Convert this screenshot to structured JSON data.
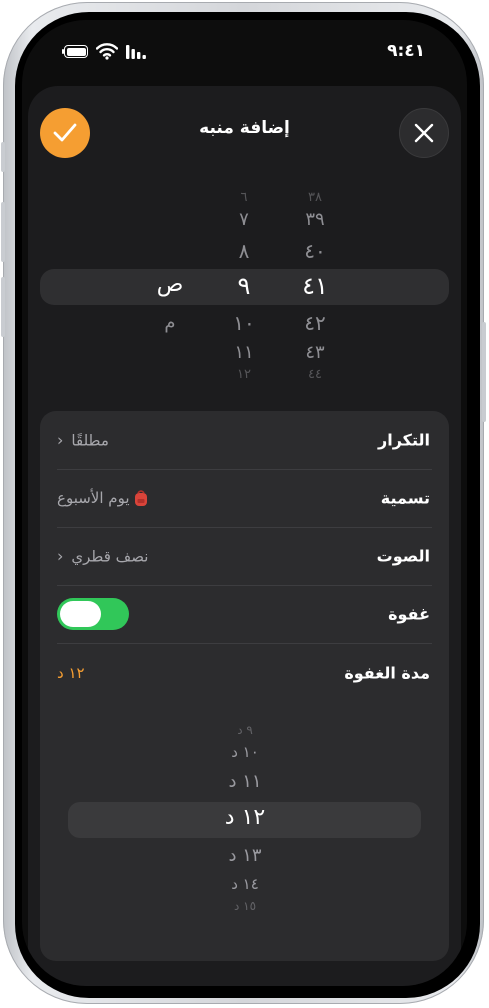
{
  "status_bar": {
    "time": "٩:٤١",
    "icons": [
      "battery-icon",
      "wifi-icon",
      "cellular-signal-icon"
    ]
  },
  "sheet": {
    "title": "إضافة منبه",
    "confirm_icon": "checkmark-icon",
    "close_icon": "close-icon"
  },
  "time_picker": {
    "minutes": [
      "٣٨",
      "٣٩",
      "٤٠",
      "٤١",
      "٤٢",
      "٤٣",
      "٤٤"
    ],
    "hours": [
      "٦",
      "٧",
      "٨",
      "٩",
      "١٠",
      "١١",
      "١٢"
    ],
    "periods": [
      "ص",
      "م"
    ],
    "selected": {
      "minute": "٤١",
      "hour": "٩",
      "period": "ص"
    }
  },
  "settings": {
    "repeat": {
      "label": "التكرار",
      "value": "مطلقًا"
    },
    "label": {
      "label": "تسمية",
      "value": "يوم الأسبوع",
      "emoji_icon": "backpack-icon"
    },
    "sound": {
      "label": "الصوت",
      "value": "نصف قطري"
    },
    "snooze": {
      "label": "غفوة",
      "enabled": true
    },
    "snooze_duration": {
      "label": "مدة الغفوة",
      "value": "١٢ د"
    }
  },
  "snooze_picker": {
    "items": [
      "٩ د",
      "١٠ د",
      "١١ د",
      "١٢ د",
      "١٣ د",
      "١٤ د",
      "١٥ د"
    ],
    "selected": "١٢ د"
  },
  "colors": {
    "accent": "#f59e32",
    "toggle_on": "#31c759",
    "sheet_bg": "#1c1c1e",
    "group_bg": "#2c2c2e"
  }
}
